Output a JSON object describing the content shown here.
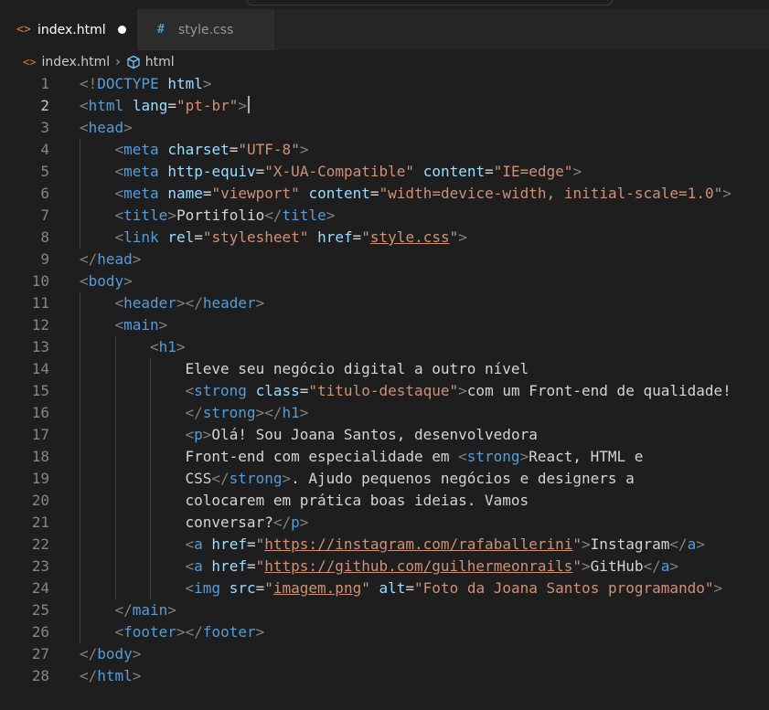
{
  "tabs": [
    {
      "icon": "html-file-icon",
      "label": "index.html",
      "active": true,
      "modified": true
    },
    {
      "icon": "css-file-icon",
      "label": "style.css",
      "active": false,
      "modified": false
    }
  ],
  "breadcrumbs": {
    "file": "index.html",
    "element": "html"
  },
  "editor": {
    "cursor_line": 2,
    "line_numbers": [
      "1",
      "2",
      "3",
      "4",
      "5",
      "6",
      "7",
      "8",
      "9",
      "10",
      "11",
      "12",
      "13",
      "14",
      "15",
      "16",
      "17",
      "18",
      "19",
      "20",
      "21",
      "22",
      "23",
      "24",
      "25",
      "26",
      "27",
      "28"
    ],
    "lines": [
      {
        "indent": 0,
        "tokens": [
          {
            "t": "b",
            "v": "<!"
          },
          {
            "t": "doc",
            "v": "DOCTYPE"
          },
          {
            "t": "txt",
            "v": " "
          },
          {
            "t": "attr",
            "v": "html"
          },
          {
            "t": "b",
            "v": ">"
          }
        ]
      },
      {
        "indent": 0,
        "tokens": [
          {
            "t": "b",
            "v": "<"
          },
          {
            "t": "tag",
            "v": "html"
          },
          {
            "t": "txt",
            "v": " "
          },
          {
            "t": "attr",
            "v": "lang"
          },
          {
            "t": "txt",
            "v": "="
          },
          {
            "t": "str",
            "v": "\"pt-br\""
          },
          {
            "t": "b",
            "v": ">"
          }
        ]
      },
      {
        "indent": 0,
        "tokens": [
          {
            "t": "b",
            "v": "<"
          },
          {
            "t": "tag",
            "v": "head"
          },
          {
            "t": "b",
            "v": ">"
          }
        ]
      },
      {
        "indent": 1,
        "tokens": [
          {
            "t": "b",
            "v": "<"
          },
          {
            "t": "tag",
            "v": "meta"
          },
          {
            "t": "txt",
            "v": " "
          },
          {
            "t": "attr",
            "v": "charset"
          },
          {
            "t": "txt",
            "v": "="
          },
          {
            "t": "str",
            "v": "\"UTF-8\""
          },
          {
            "t": "b",
            "v": ">"
          }
        ]
      },
      {
        "indent": 1,
        "tokens": [
          {
            "t": "b",
            "v": "<"
          },
          {
            "t": "tag",
            "v": "meta"
          },
          {
            "t": "txt",
            "v": " "
          },
          {
            "t": "attr",
            "v": "http-equiv"
          },
          {
            "t": "txt",
            "v": "="
          },
          {
            "t": "str",
            "v": "\"X-UA-Compatible\""
          },
          {
            "t": "txt",
            "v": " "
          },
          {
            "t": "attr",
            "v": "content"
          },
          {
            "t": "txt",
            "v": "="
          },
          {
            "t": "str",
            "v": "\"IE=edge\""
          },
          {
            "t": "b",
            "v": ">"
          }
        ]
      },
      {
        "indent": 1,
        "tokens": [
          {
            "t": "b",
            "v": "<"
          },
          {
            "t": "tag",
            "v": "meta"
          },
          {
            "t": "txt",
            "v": " "
          },
          {
            "t": "attr",
            "v": "name"
          },
          {
            "t": "txt",
            "v": "="
          },
          {
            "t": "str",
            "v": "\"viewport\""
          },
          {
            "t": "txt",
            "v": " "
          },
          {
            "t": "attr",
            "v": "content"
          },
          {
            "t": "txt",
            "v": "="
          },
          {
            "t": "str",
            "v": "\"width=device-width, initial-scale=1.0\""
          },
          {
            "t": "b",
            "v": ">"
          }
        ]
      },
      {
        "indent": 1,
        "tokens": [
          {
            "t": "b",
            "v": "<"
          },
          {
            "t": "tag",
            "v": "title"
          },
          {
            "t": "b",
            "v": ">"
          },
          {
            "t": "txt",
            "v": "Portifolio"
          },
          {
            "t": "b",
            "v": "</"
          },
          {
            "t": "tag",
            "v": "title"
          },
          {
            "t": "b",
            "v": ">"
          }
        ]
      },
      {
        "indent": 1,
        "tokens": [
          {
            "t": "b",
            "v": "<"
          },
          {
            "t": "tag",
            "v": "link"
          },
          {
            "t": "txt",
            "v": " "
          },
          {
            "t": "attr",
            "v": "rel"
          },
          {
            "t": "txt",
            "v": "="
          },
          {
            "t": "str",
            "v": "\"stylesheet\""
          },
          {
            "t": "txt",
            "v": " "
          },
          {
            "t": "attr",
            "v": "href"
          },
          {
            "t": "txt",
            "v": "="
          },
          {
            "t": "str",
            "v": "\""
          },
          {
            "t": "link",
            "v": "style.css"
          },
          {
            "t": "str",
            "v": "\""
          },
          {
            "t": "b",
            "v": ">"
          }
        ]
      },
      {
        "indent": 0,
        "tokens": [
          {
            "t": "b",
            "v": "</"
          },
          {
            "t": "tag",
            "v": "head"
          },
          {
            "t": "b",
            "v": ">"
          }
        ]
      },
      {
        "indent": 0,
        "tokens": [
          {
            "t": "b",
            "v": "<"
          },
          {
            "t": "tag",
            "v": "body"
          },
          {
            "t": "b",
            "v": ">"
          }
        ]
      },
      {
        "indent": 1,
        "tokens": [
          {
            "t": "b",
            "v": "<"
          },
          {
            "t": "tag",
            "v": "header"
          },
          {
            "t": "b",
            "v": "></"
          },
          {
            "t": "tag",
            "v": "header"
          },
          {
            "t": "b",
            "v": ">"
          }
        ]
      },
      {
        "indent": 1,
        "tokens": [
          {
            "t": "b",
            "v": "<"
          },
          {
            "t": "tag",
            "v": "main"
          },
          {
            "t": "b",
            "v": ">"
          }
        ]
      },
      {
        "indent": 2,
        "tokens": [
          {
            "t": "b",
            "v": "<"
          },
          {
            "t": "tag",
            "v": "h1"
          },
          {
            "t": "b",
            "v": ">"
          }
        ]
      },
      {
        "indent": 3,
        "tokens": [
          {
            "t": "txt",
            "v": "Eleve seu negócio digital a outro nível"
          }
        ]
      },
      {
        "indent": 3,
        "tokens": [
          {
            "t": "b",
            "v": "<"
          },
          {
            "t": "tag",
            "v": "strong"
          },
          {
            "t": "txt",
            "v": " "
          },
          {
            "t": "attr",
            "v": "class"
          },
          {
            "t": "txt",
            "v": "="
          },
          {
            "t": "str",
            "v": "\"titulo-destaque\""
          },
          {
            "t": "b",
            "v": ">"
          },
          {
            "t": "txt",
            "v": "com um Front-end de qualidade!"
          }
        ]
      },
      {
        "indent": 3,
        "tokens": [
          {
            "t": "b",
            "v": "</"
          },
          {
            "t": "tag",
            "v": "strong"
          },
          {
            "t": "b",
            "v": "></"
          },
          {
            "t": "tag",
            "v": "h1"
          },
          {
            "t": "b",
            "v": ">"
          }
        ]
      },
      {
        "indent": 3,
        "tokens": [
          {
            "t": "b",
            "v": "<"
          },
          {
            "t": "tag",
            "v": "p"
          },
          {
            "t": "b",
            "v": ">"
          },
          {
            "t": "txt",
            "v": "Olá! Sou Joana Santos, desenvolvedora"
          }
        ]
      },
      {
        "indent": 3,
        "tokens": [
          {
            "t": "txt",
            "v": "Front-end com especialidade em "
          },
          {
            "t": "b",
            "v": "<"
          },
          {
            "t": "tag",
            "v": "strong"
          },
          {
            "t": "b",
            "v": ">"
          },
          {
            "t": "txt",
            "v": "React, HTML e"
          }
        ]
      },
      {
        "indent": 3,
        "tokens": [
          {
            "t": "txt",
            "v": "CSS"
          },
          {
            "t": "b",
            "v": "</"
          },
          {
            "t": "tag",
            "v": "strong"
          },
          {
            "t": "b",
            "v": ">"
          },
          {
            "t": "txt",
            "v": ". Ajudo pequenos negócios e designers a"
          }
        ]
      },
      {
        "indent": 3,
        "tokens": [
          {
            "t": "txt",
            "v": "colocarem em prática boas ideias. Vamos"
          }
        ]
      },
      {
        "indent": 3,
        "tokens": [
          {
            "t": "txt",
            "v": "conversar?"
          },
          {
            "t": "b",
            "v": "</"
          },
          {
            "t": "tag",
            "v": "p"
          },
          {
            "t": "b",
            "v": ">"
          }
        ]
      },
      {
        "indent": 3,
        "tokens": [
          {
            "t": "b",
            "v": "<"
          },
          {
            "t": "tag",
            "v": "a"
          },
          {
            "t": "txt",
            "v": " "
          },
          {
            "t": "attr",
            "v": "href"
          },
          {
            "t": "txt",
            "v": "="
          },
          {
            "t": "str",
            "v": "\""
          },
          {
            "t": "link",
            "v": "https://instagram.com/rafaballerini"
          },
          {
            "t": "str",
            "v": "\""
          },
          {
            "t": "b",
            "v": ">"
          },
          {
            "t": "txt",
            "v": "Instagram"
          },
          {
            "t": "b",
            "v": "</"
          },
          {
            "t": "tag",
            "v": "a"
          },
          {
            "t": "b",
            "v": ">"
          }
        ]
      },
      {
        "indent": 3,
        "tokens": [
          {
            "t": "b",
            "v": "<"
          },
          {
            "t": "tag",
            "v": "a"
          },
          {
            "t": "txt",
            "v": " "
          },
          {
            "t": "attr",
            "v": "href"
          },
          {
            "t": "txt",
            "v": "="
          },
          {
            "t": "str",
            "v": "\""
          },
          {
            "t": "link",
            "v": "https://github.com/guilhermeonrails"
          },
          {
            "t": "str",
            "v": "\""
          },
          {
            "t": "b",
            "v": ">"
          },
          {
            "t": "txt",
            "v": "GitHub"
          },
          {
            "t": "b",
            "v": "</"
          },
          {
            "t": "tag",
            "v": "a"
          },
          {
            "t": "b",
            "v": ">"
          }
        ]
      },
      {
        "indent": 3,
        "tokens": [
          {
            "t": "b",
            "v": "<"
          },
          {
            "t": "tag",
            "v": "img"
          },
          {
            "t": "txt",
            "v": " "
          },
          {
            "t": "attr",
            "v": "src"
          },
          {
            "t": "txt",
            "v": "="
          },
          {
            "t": "str",
            "v": "\""
          },
          {
            "t": "link",
            "v": "imagem.png"
          },
          {
            "t": "str",
            "v": "\""
          },
          {
            "t": "txt",
            "v": " "
          },
          {
            "t": "attr",
            "v": "alt"
          },
          {
            "t": "txt",
            "v": "="
          },
          {
            "t": "str",
            "v": "\"Foto da Joana Santos programando\""
          },
          {
            "t": "b",
            "v": ">"
          }
        ]
      },
      {
        "indent": 1,
        "tokens": [
          {
            "t": "b",
            "v": "</"
          },
          {
            "t": "tag",
            "v": "main"
          },
          {
            "t": "b",
            "v": ">"
          }
        ]
      },
      {
        "indent": 1,
        "tokens": [
          {
            "t": "b",
            "v": "<"
          },
          {
            "t": "tag",
            "v": "footer"
          },
          {
            "t": "b",
            "v": "></"
          },
          {
            "t": "tag",
            "v": "footer"
          },
          {
            "t": "b",
            "v": ">"
          }
        ]
      },
      {
        "indent": 0,
        "tokens": [
          {
            "t": "b",
            "v": "</"
          },
          {
            "t": "tag",
            "v": "body"
          },
          {
            "t": "b",
            "v": ">"
          }
        ]
      },
      {
        "indent": 0,
        "tokens": [
          {
            "t": "b",
            "v": "</"
          },
          {
            "t": "tag",
            "v": "html"
          },
          {
            "t": "b",
            "v": ">"
          }
        ]
      }
    ]
  },
  "colors": {
    "editor_bg": "#1e1e1e",
    "tag": "#569cd6",
    "attribute": "#9cdcfe",
    "string": "#ce9178",
    "bracket": "#808080",
    "text": "#d4d4d4",
    "line_number": "#858585",
    "html_icon": "#e37933",
    "css_icon": "#519aba"
  }
}
